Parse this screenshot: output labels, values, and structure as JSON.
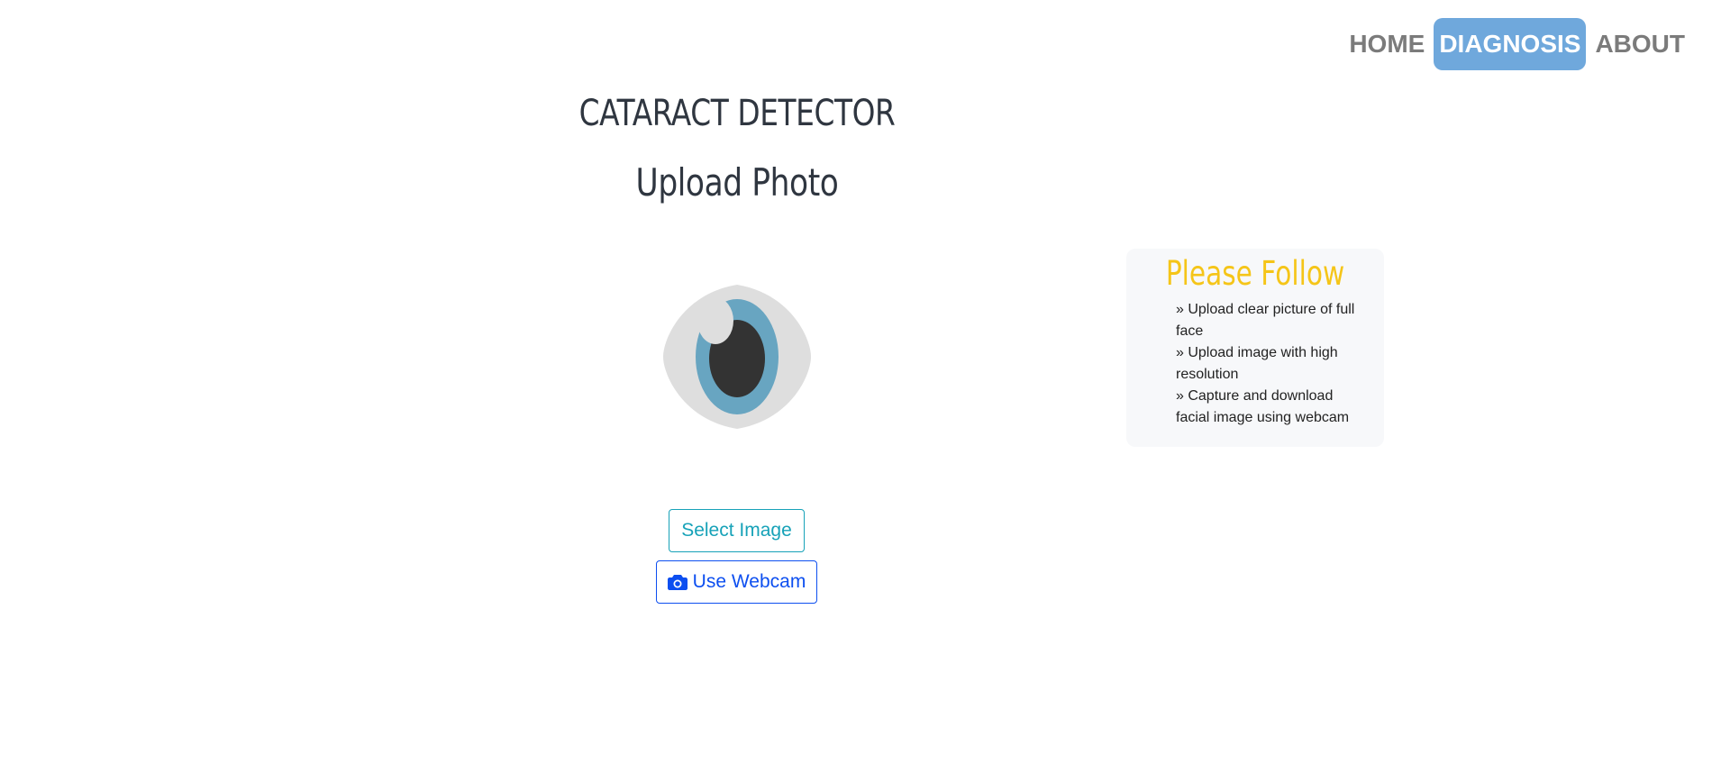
{
  "nav": {
    "items": [
      {
        "label": "HOME",
        "active": false
      },
      {
        "label": "DIAGNOSIS",
        "active": true
      },
      {
        "label": "ABOUT",
        "active": false
      }
    ],
    "active_color": "#6fa8dc"
  },
  "header": {
    "title": "CATARACT DETECTOR",
    "subtitle": "Upload Photo"
  },
  "preview": {
    "icon": "eye-icon"
  },
  "actions": {
    "select_label": "Select Image",
    "webcam_label": "Use Webcam",
    "webcam_icon": "camera-icon"
  },
  "instructions": {
    "title": "Please Follow",
    "title_color": "#f5c518",
    "items": [
      "» Upload clear picture of full face",
      "» Upload image with high resolution",
      "» Capture and download facial image using webcam"
    ]
  }
}
